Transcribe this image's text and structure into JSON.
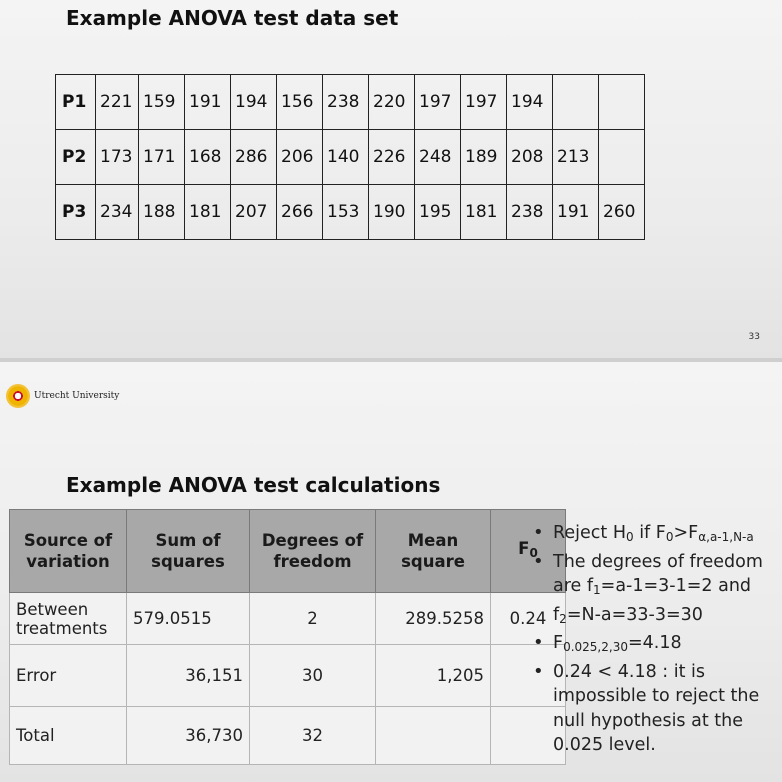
{
  "slide1": {
    "title": "Example ANOVA test data set",
    "page_number": "33",
    "rows": [
      {
        "label": "P1",
        "values": [
          "221",
          "159",
          "191",
          "194",
          "156",
          "238",
          "220",
          "197",
          "197",
          "194",
          "",
          ""
        ]
      },
      {
        "label": "P2",
        "values": [
          "173",
          "171",
          "168",
          "286",
          "206",
          "140",
          "226",
          "248",
          "189",
          "208",
          "213",
          ""
        ]
      },
      {
        "label": "P3",
        "values": [
          "234",
          "188",
          "181",
          "207",
          "266",
          "153",
          "190",
          "195",
          "181",
          "238",
          "191",
          "260"
        ]
      }
    ]
  },
  "slide2": {
    "logo_text": "Utrecht University",
    "title": "Example ANOVA test calculations",
    "table": {
      "headers": {
        "source": "Source of variation",
        "ss": "Sum of squares",
        "df": "Degrees of freedom",
        "ms": "Mean square",
        "f0_main": "F",
        "f0_sub": "0"
      },
      "rows": [
        {
          "source": "Between treatments",
          "ss": "579.0515",
          "df": "2",
          "ms": "289.5258",
          "f0": "0.24"
        },
        {
          "source": "Error",
          "ss": "36,151",
          "df": "30",
          "ms": "1,205",
          "f0": ""
        },
        {
          "source": "Total",
          "ss": "36,730",
          "df": "32",
          "ms": "",
          "f0": ""
        }
      ]
    },
    "bullets": {
      "b1": {
        "t1": "Reject H",
        "s1": "0",
        "t2": " if F",
        "s2": "0",
        "t3": ">F",
        "s3": "α,a-1,N-a"
      },
      "b2": {
        "t1": "The degrees of freedom are f",
        "s1": "1",
        "t2": "=a-1=3-1=2 and f",
        "s2": "2",
        "t3": "=N-a=33-3=30"
      },
      "b3": {
        "t1": "F",
        "s1": "0.025,2,30",
        "t2": "=4.18"
      },
      "b4": {
        "t1": "0.24 < 4.18 : it is impossible to reject the null hypothesis at the 0.025 level."
      }
    }
  }
}
